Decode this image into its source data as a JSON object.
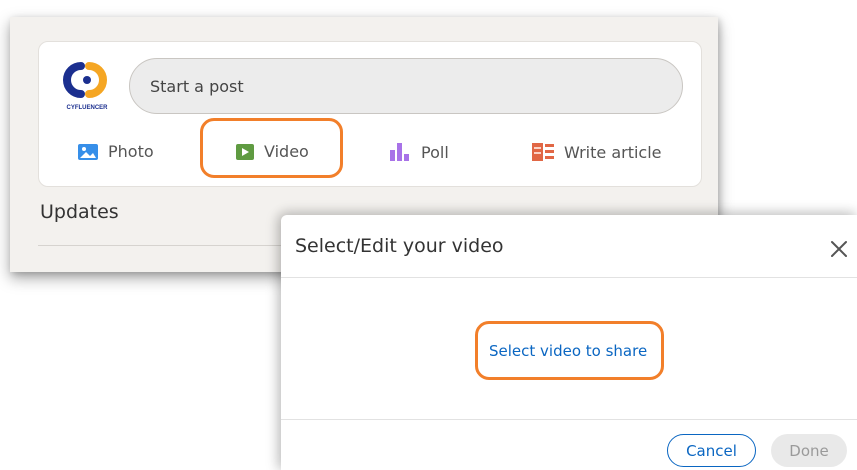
{
  "feed": {
    "logo_text": "CYFLUENCER",
    "start_post_placeholder": "Start a post",
    "actions": [
      {
        "label": "Photo",
        "icon": "photo-icon",
        "color": "#378fe9"
      },
      {
        "label": "Video",
        "icon": "video-icon",
        "color": "#5f9b41"
      },
      {
        "label": "Poll",
        "icon": "poll-icon",
        "color": "#a872e8"
      },
      {
        "label": "Write article",
        "icon": "article-icon",
        "color": "#e16745"
      }
    ],
    "updates_heading": "Updates"
  },
  "dialog": {
    "title": "Select/Edit your video",
    "close_icon": "close-icon",
    "select_link": "Select video to share",
    "cancel_label": "Cancel",
    "done_label": "Done"
  },
  "colors": {
    "highlight": "#f27f2a",
    "link": "#0a66c2"
  }
}
